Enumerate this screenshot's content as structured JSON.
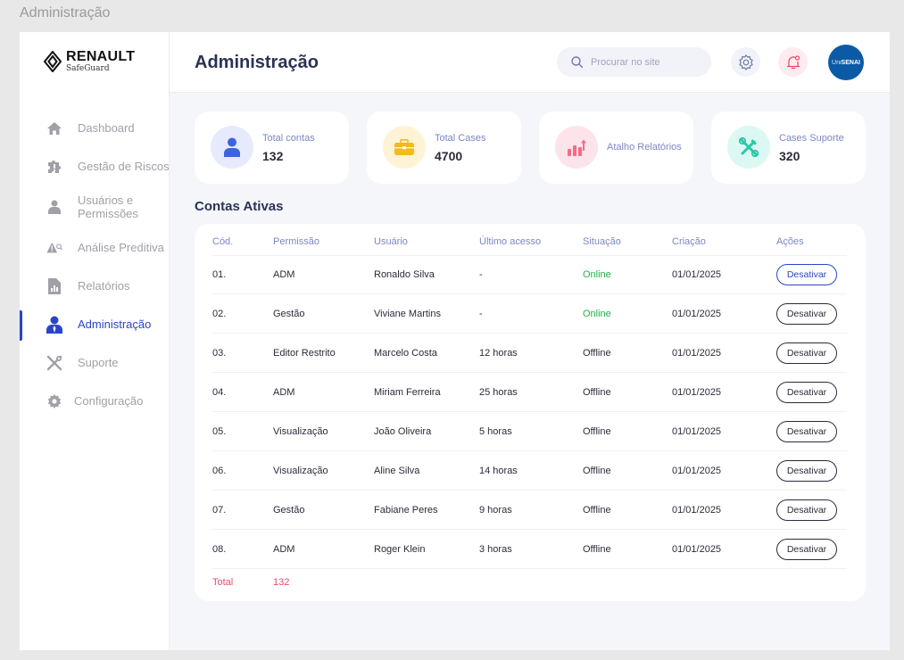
{
  "window": {
    "title": "Administração"
  },
  "brand": {
    "name": "RENAULT",
    "sub": "SafeGuard"
  },
  "sidebar": {
    "items": [
      {
        "label": "Dashboard",
        "icon": "home-icon",
        "active": false
      },
      {
        "label": "Gestão de Riscos",
        "icon": "puzzle-icon",
        "active": false
      },
      {
        "label": "Usuários e Permissões",
        "icon": "user-icon",
        "active": false
      },
      {
        "label": "Análise Preditiva",
        "icon": "warning-search-icon",
        "active": false
      },
      {
        "label": "Relatórios",
        "icon": "report-icon",
        "active": false
      },
      {
        "label": "Administração",
        "icon": "admin-user-icon",
        "active": true
      },
      {
        "label": "Suporte",
        "icon": "tools-icon",
        "active": false
      },
      {
        "label": "Configuração",
        "icon": "gear-icon",
        "active": false
      }
    ]
  },
  "header": {
    "title": "Administração",
    "search_placeholder": "Procurar no site",
    "avatar_text_uni": "Uni",
    "avatar_text_senai": "SENAI"
  },
  "cards": [
    {
      "label": "Total contas",
      "value": "132",
      "icon": "user-icon",
      "bg": "#e6eafc",
      "fg": "#3d63e0"
    },
    {
      "label": "Total Cases",
      "value": "4700",
      "icon": "briefcase-icon",
      "bg": "#fff3d6",
      "fg": "#f5b91e"
    },
    {
      "label": "Atalho Relatórios",
      "value": "",
      "icon": "chart-up-icon",
      "bg": "#fde3ea",
      "fg": "#f26b8a"
    },
    {
      "label": "Cases Suporte",
      "value": "320",
      "icon": "tools-icon",
      "bg": "#dcf8f3",
      "fg": "#27c9a8"
    }
  ],
  "section": {
    "title": "Contas Ativas"
  },
  "table": {
    "columns": [
      "Cód.",
      "Permissão",
      "Usuário",
      "Último acesso",
      "Situação",
      "Criação",
      "Ações"
    ],
    "rows": [
      {
        "cod": "01.",
        "perm": "ADM",
        "user": "Ronaldo Silva",
        "last": "-",
        "status": "Online",
        "created": "01/01/2025",
        "action": "Desativar"
      },
      {
        "cod": "02.",
        "perm": "Gestão",
        "user": "Viviane Martins",
        "last": "-",
        "status": "Online",
        "created": "01/01/2025",
        "action": "Desativar"
      },
      {
        "cod": "03.",
        "perm": "Editor Restrito",
        "user": "Marcelo Costa",
        "last": "12 horas",
        "status": "Offline",
        "created": "01/01/2025",
        "action": "Desativar"
      },
      {
        "cod": "04.",
        "perm": "ADM",
        "user": "Miriam Ferreira",
        "last": "25 horas",
        "status": "Offline",
        "created": "01/01/2025",
        "action": "Desativar"
      },
      {
        "cod": "05.",
        "perm": "Visualização",
        "user": "João Oliveira",
        "last": "5 horas",
        "status": "Offline",
        "created": "01/01/2025",
        "action": "Desativar"
      },
      {
        "cod": "06.",
        "perm": "Visualização",
        "user": "Aline Silva",
        "last": "14 horas",
        "status": "Offline",
        "created": "01/01/2025",
        "action": "Desativar"
      },
      {
        "cod": "07.",
        "perm": "Gestão",
        "user": "Fabiane Peres",
        "last": "9 horas",
        "status": "Offline",
        "created": "01/01/2025",
        "action": "Desativar"
      },
      {
        "cod": "08.",
        "perm": "ADM",
        "user": "Roger Klein",
        "last": "3 horas",
        "status": "Offline",
        "created": "01/01/2025",
        "action": "Desativar"
      }
    ],
    "total_label": "Total",
    "total_value": "132"
  },
  "colors": {
    "accent": "#2a45c9",
    "online": "#1fb24a",
    "total": "#e64b6b"
  }
}
